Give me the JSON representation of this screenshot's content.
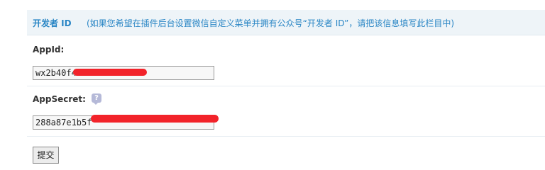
{
  "header": {
    "title": "开发者 ID",
    "description": "(如果您希望在插件后台设置微信自定义菜单并拥有公众号“开发者 ID”，请把该信息填写此栏目中)"
  },
  "appid": {
    "label": "AppId:",
    "value": "wx2b40f45"
  },
  "appsecret": {
    "label": "AppSecret:",
    "value": "288a87e1b5f",
    "help_icon": "question-bubble-icon"
  },
  "submit": {
    "label": "提交"
  },
  "colors": {
    "header_bg": "#eef4f8",
    "header_text": "#2a86c5",
    "redaction": "#f2232a"
  }
}
